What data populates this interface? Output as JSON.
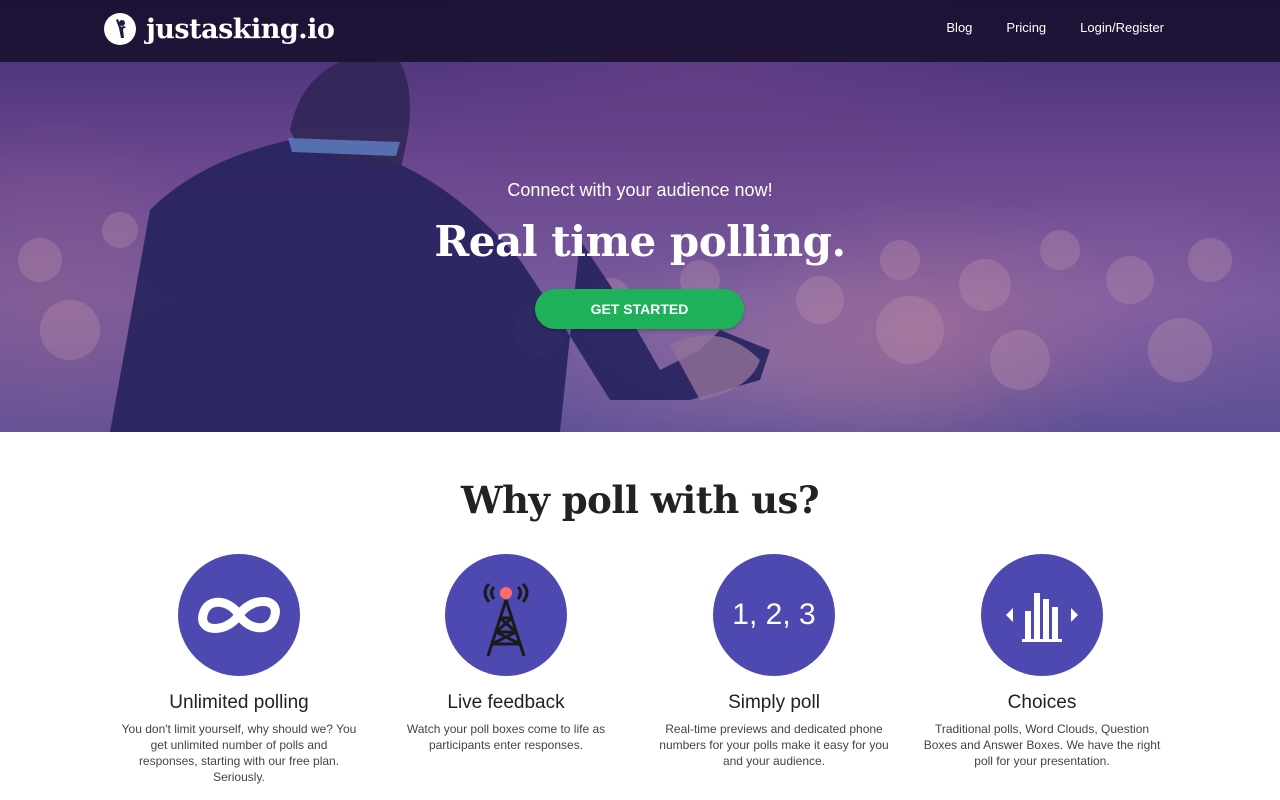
{
  "brand": {
    "name": "justasking.io",
    "icon": "raised-hand-icon"
  },
  "nav": {
    "items": [
      "Blog",
      "Pricing",
      "Login/Register"
    ]
  },
  "hero": {
    "tagline": "Connect with your audience now!",
    "headline": "Real time polling.",
    "cta_label": "GET STARTED"
  },
  "features": {
    "title": "Why poll with us?",
    "items": [
      {
        "icon": "infinity-icon",
        "title": "Unlimited polling",
        "desc": "You don't limit yourself, why should we? You get unlimited number of polls and responses, starting with our free plan. Seriously."
      },
      {
        "icon": "broadcast-tower-icon",
        "title": "Live feedback",
        "desc": "Watch your poll boxes come to life as participants enter responses."
      },
      {
        "icon": "numbers-icon",
        "icon_text": "1, 2, 3",
        "title": "Simply poll",
        "desc": "Real-time previews and dedicated phone numbers for your polls make it easy for you and your audience."
      },
      {
        "icon": "bar-chart-carousel-icon",
        "title": "Choices",
        "desc": "Traditional polls, Word Clouds, Question Boxes and Answer Boxes. We have the right poll for your presentation."
      }
    ]
  },
  "colors": {
    "accent": "#4e49b0",
    "cta": "#1fb15a",
    "navbar": "#140e28"
  }
}
